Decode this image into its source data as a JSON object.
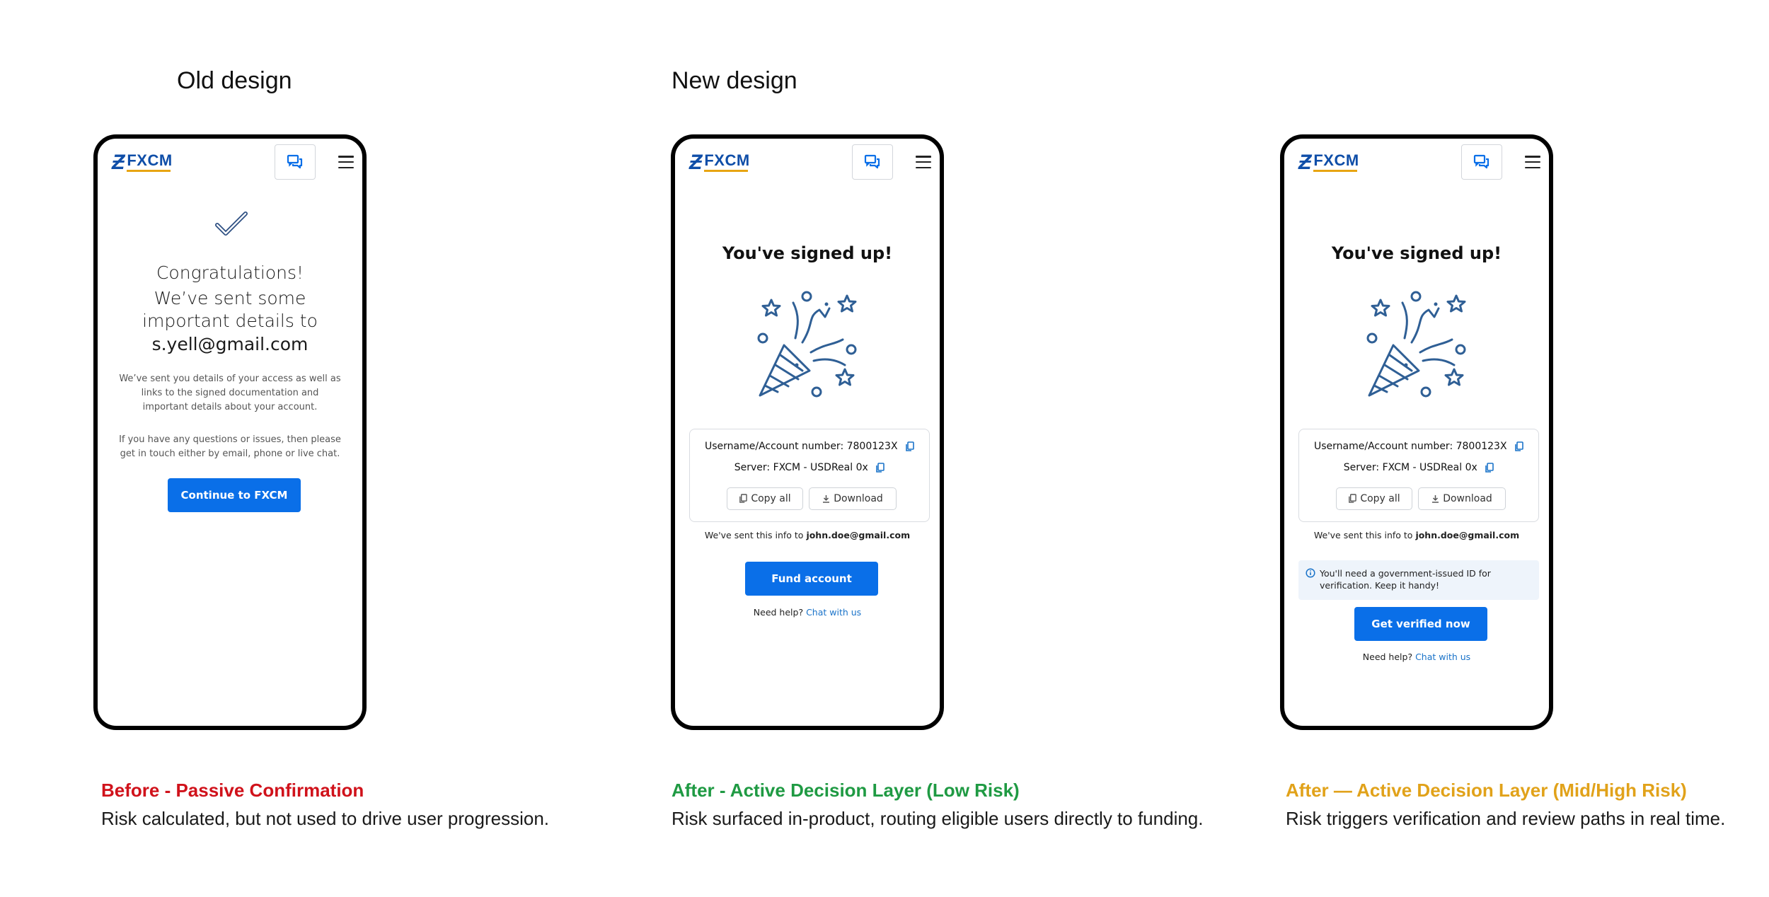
{
  "headings": {
    "old": "Old design",
    "new": "New design"
  },
  "brand": {
    "name": "FXCM",
    "primary_color": "#0a6fe8",
    "logo_color": "#0f4ea8"
  },
  "icons": {
    "chat": "chat-icon",
    "menu": "hamburger-menu-icon",
    "check": "checkmark-icon",
    "party": "party-popper-icon",
    "copy": "copy-icon",
    "download": "download-icon",
    "info": "info-icon"
  },
  "old_screen": {
    "congrats": "Congratulations!",
    "sent_line": "We’ve sent some important details to",
    "email": "s.yell@gmail.com",
    "body1": "We’ve sent you details of your access as well as links to the signed documentation and important details about your account.",
    "body2": "If you have any questions or issues, then please get in touch either by email, phone or live chat.",
    "cta": "Continue to FXCM"
  },
  "low_screen": {
    "title": "You've signed up!",
    "username_line": "Username/Account number: 7800123X",
    "server_line": "Server: FXCM - USDReal 0x",
    "copy_all": "Copy all",
    "download": "Download",
    "sent_prefix": "We've sent this info to",
    "sent_email": "john.doe@gmail.com",
    "cta": "Fund account",
    "help_prefix": "Need help?",
    "help_link": "Chat with us"
  },
  "high_screen": {
    "title": "You've signed up!",
    "username_line": "Username/Account number: 7800123X",
    "server_line": "Server: FXCM - USDReal 0x",
    "copy_all": "Copy all",
    "download": "Download",
    "sent_prefix": "We've sent this info to",
    "sent_email": "john.doe@gmail.com",
    "notice": "You'll need a government-issued ID for verification. Keep it handy!",
    "cta": "Get verified now",
    "help_prefix": "Need help?",
    "help_link": "Chat with us"
  },
  "captions": [
    {
      "title": "Before - Passive Confirmation",
      "subtitle": "Risk calculated, but not used to drive user progression.",
      "color": "#d0121b"
    },
    {
      "title": "After - Active Decision Layer (Low Risk)",
      "subtitle": "Risk surfaced in-product, routing eligible users directly to funding.",
      "color": "#1f9a43"
    },
    {
      "title": "After — Active Decision Layer (Mid/High Risk)",
      "subtitle": "Risk triggers verification and review paths in real time.",
      "color": "#e1a21a"
    }
  ]
}
